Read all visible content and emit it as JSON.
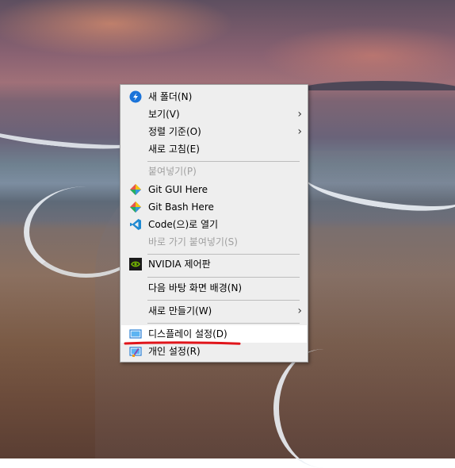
{
  "menu": {
    "items": [
      {
        "label": "새 폴더(N)",
        "icon": "new-folder-icon"
      },
      {
        "label": "보기(V)"
      },
      {
        "label": "정렬 기준(O)"
      },
      {
        "label": "새로 고침(E)"
      },
      {
        "label": "붙여넣기(P)"
      },
      {
        "label": "Git GUI Here",
        "icon": "git-icon"
      },
      {
        "label": "Git Bash Here",
        "icon": "git-icon"
      },
      {
        "label": "Code(으)로 열기",
        "icon": "vscode-icon"
      },
      {
        "label": "바로 가기 붙여넣기(S)"
      },
      {
        "label": "NVIDIA 제어판",
        "icon": "nvidia-icon"
      },
      {
        "label": "다음 바탕 화면 배경(N)"
      },
      {
        "label": "새로 만들기(W)"
      },
      {
        "label": "디스플레이 설정(D)",
        "icon": "display-icon"
      },
      {
        "label": "개인 설정(R)",
        "icon": "personalize-icon"
      }
    ]
  },
  "colors": {
    "menu_bg": "#eeeeee",
    "hover_bg": "#ffffff",
    "annotation_red": "#e0151b",
    "disabled_text": "#a0a0a0"
  }
}
